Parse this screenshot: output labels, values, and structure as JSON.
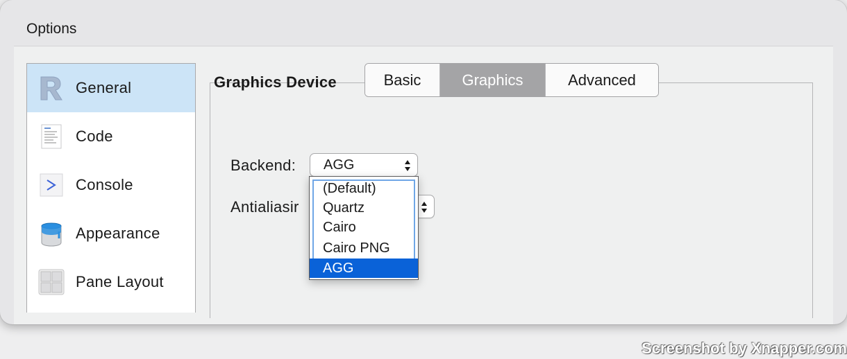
{
  "window": {
    "title": "Options"
  },
  "sidebar": {
    "items": [
      {
        "label": "General",
        "icon": "r-logo-icon",
        "selected": true
      },
      {
        "label": "Code",
        "icon": "code-document-icon",
        "selected": false
      },
      {
        "label": "Console",
        "icon": "console-prompt-icon",
        "selected": false
      },
      {
        "label": "Appearance",
        "icon": "paint-bucket-icon",
        "selected": false
      },
      {
        "label": "Pane Layout",
        "icon": "pane-grid-icon",
        "selected": false
      }
    ]
  },
  "tabs": [
    {
      "label": "Basic",
      "active": false
    },
    {
      "label": "Graphics",
      "active": true
    },
    {
      "label": "Advanced",
      "active": false
    }
  ],
  "graphics": {
    "heading": "Graphics Device",
    "backend_label": "Backend:",
    "backend_value": "AGG",
    "antialiasing_label": "Antialiasir",
    "dropdown": {
      "options": [
        "(Default)",
        "Quartz",
        "Cairo",
        "Cairo PNG",
        "AGG"
      ],
      "selected": "AGG"
    }
  },
  "watermark": "Screenshot by Xnapper.com",
  "colors": {
    "selection_blue": "#0a62d8",
    "sidebar_selected": "#cce4f7",
    "active_tab": "#a4a4a6"
  }
}
